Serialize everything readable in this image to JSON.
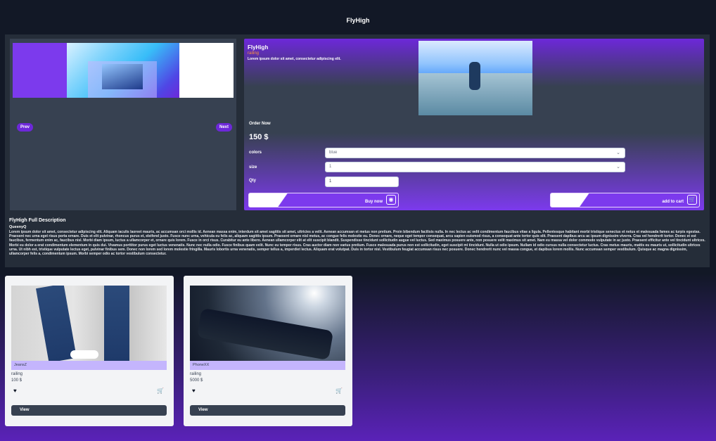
{
  "app": {
    "title": "FlyHigh"
  },
  "slider": {
    "prev_label": "Prev",
    "next_label": "Next"
  },
  "product": {
    "name": "FlyHigh",
    "rating": "railing",
    "short_description": "Lorem ipsum dolor sit amet, consectetur adipiscing elit.",
    "order_label": "Order Now",
    "price": "150 $",
    "options": {
      "colors_label": "colors",
      "colors_value": "blue",
      "size_label": "size",
      "size_value": "1",
      "qty_label": "Qty",
      "qty_value": "1"
    },
    "buy_label": "Buy now",
    "cart_label": "add to cart"
  },
  "full_description": {
    "title": "FlyHigh Full Description",
    "author": "QueenyQ",
    "body": "Lorem ipsum dolor sit amet, consectetur adipiscing elit. Aliquam iaculis laoreet mauris, ac accumsan orci mollis id. Aenean massa enim, interdum sit amet sagittis sit amet, ultricies a velit. Aenean accumsan et metus non pretium. Proin bibendum facilisis nulla. In nec lectus ac velit condimentum faucibus vitae a ligula. Pellentesque habitant morbi tristique senectus et netus et malesuada fames ac turpis egestas. Praesent nec urna eget risus porta ornare. Duis et elit pulvinar, rhoncus purus et, eleifend justo. Fusce nunc urna, vehicula eu felis ac, aliquam sagittis ipsum. Praesent ornare nisl metus, ac congue felis molestie eu. Donec ornare, neque eget tempor consequat, arcu sapien euismod risus, a consequat ante tortor quis elit. Praesent dapibus arcu ac ipsum dignissim viverra. Cras vel hendrerit tortor. Donec et est faucibus, fermentum enim ac, faucibus nisl. Morbi diam ipsum, luctus a ullamcorper et, ornare quis lorem. Fusce in orci risus. Curabitur eu ante libero. Aenean ullamcorper elit at elit suscipit blandit. Suspendisse tincidunt sollicitudin augue vel luctus. Sed maximus posuere ante, non posuere velit maximus sit amet. Nam eu massa vel dolor commodo vulputate in ac justo. Praesent efficitur ante vel tincidunt ultrices. Morbi eu dolor a erat condimentum elementum in quis dui. Vivamus porttitor purus eget luctus venenatis. Nunc nec nulla odio. Fusce finibus quam velit. Nunc eu tempor risus. Cras auctor diam non varius pretium. Fusce malesuada purus non est sollicitudin, eget suscipit mi tincidunt. Nulla ut odio ipsum. Nullam id odio cursus nulla consectetur luctus. Cras metus mauris, mattis eu mauris ut, sollicitudin ultrices urna. Ut nibh est, tristique vulputate lectus eget, pulvinar finibus sem. Donec non lorem sed lorem molestie fringilla. Mauris lobortis urna venenatis, semper tellus a, imperdiet lectus. Aliquam erat volutpat. Duis in tortor nisl. Vestibulum feugiat accumsan risus nec posuere. Donec hendrerit nunc vel massa congue, et dapibus lorem mollis. Nunc accumsan semper vestibulum. Quisque ac magna dignissim, ullamcorper felis a, condimentum ipsum. Morbi semper odio ac tortor vestibulum consectetur."
  },
  "products": [
    {
      "name": "JeansZ",
      "rating": "railing",
      "price": "100 $",
      "view_label": "View"
    },
    {
      "name": "PhoneXX",
      "rating": "railing",
      "price": "5000 $",
      "view_label": "View"
    }
  ],
  "icons": {
    "heart": "heart-icon",
    "cart": "cart-icon",
    "chevron": "chevron-down-icon"
  }
}
